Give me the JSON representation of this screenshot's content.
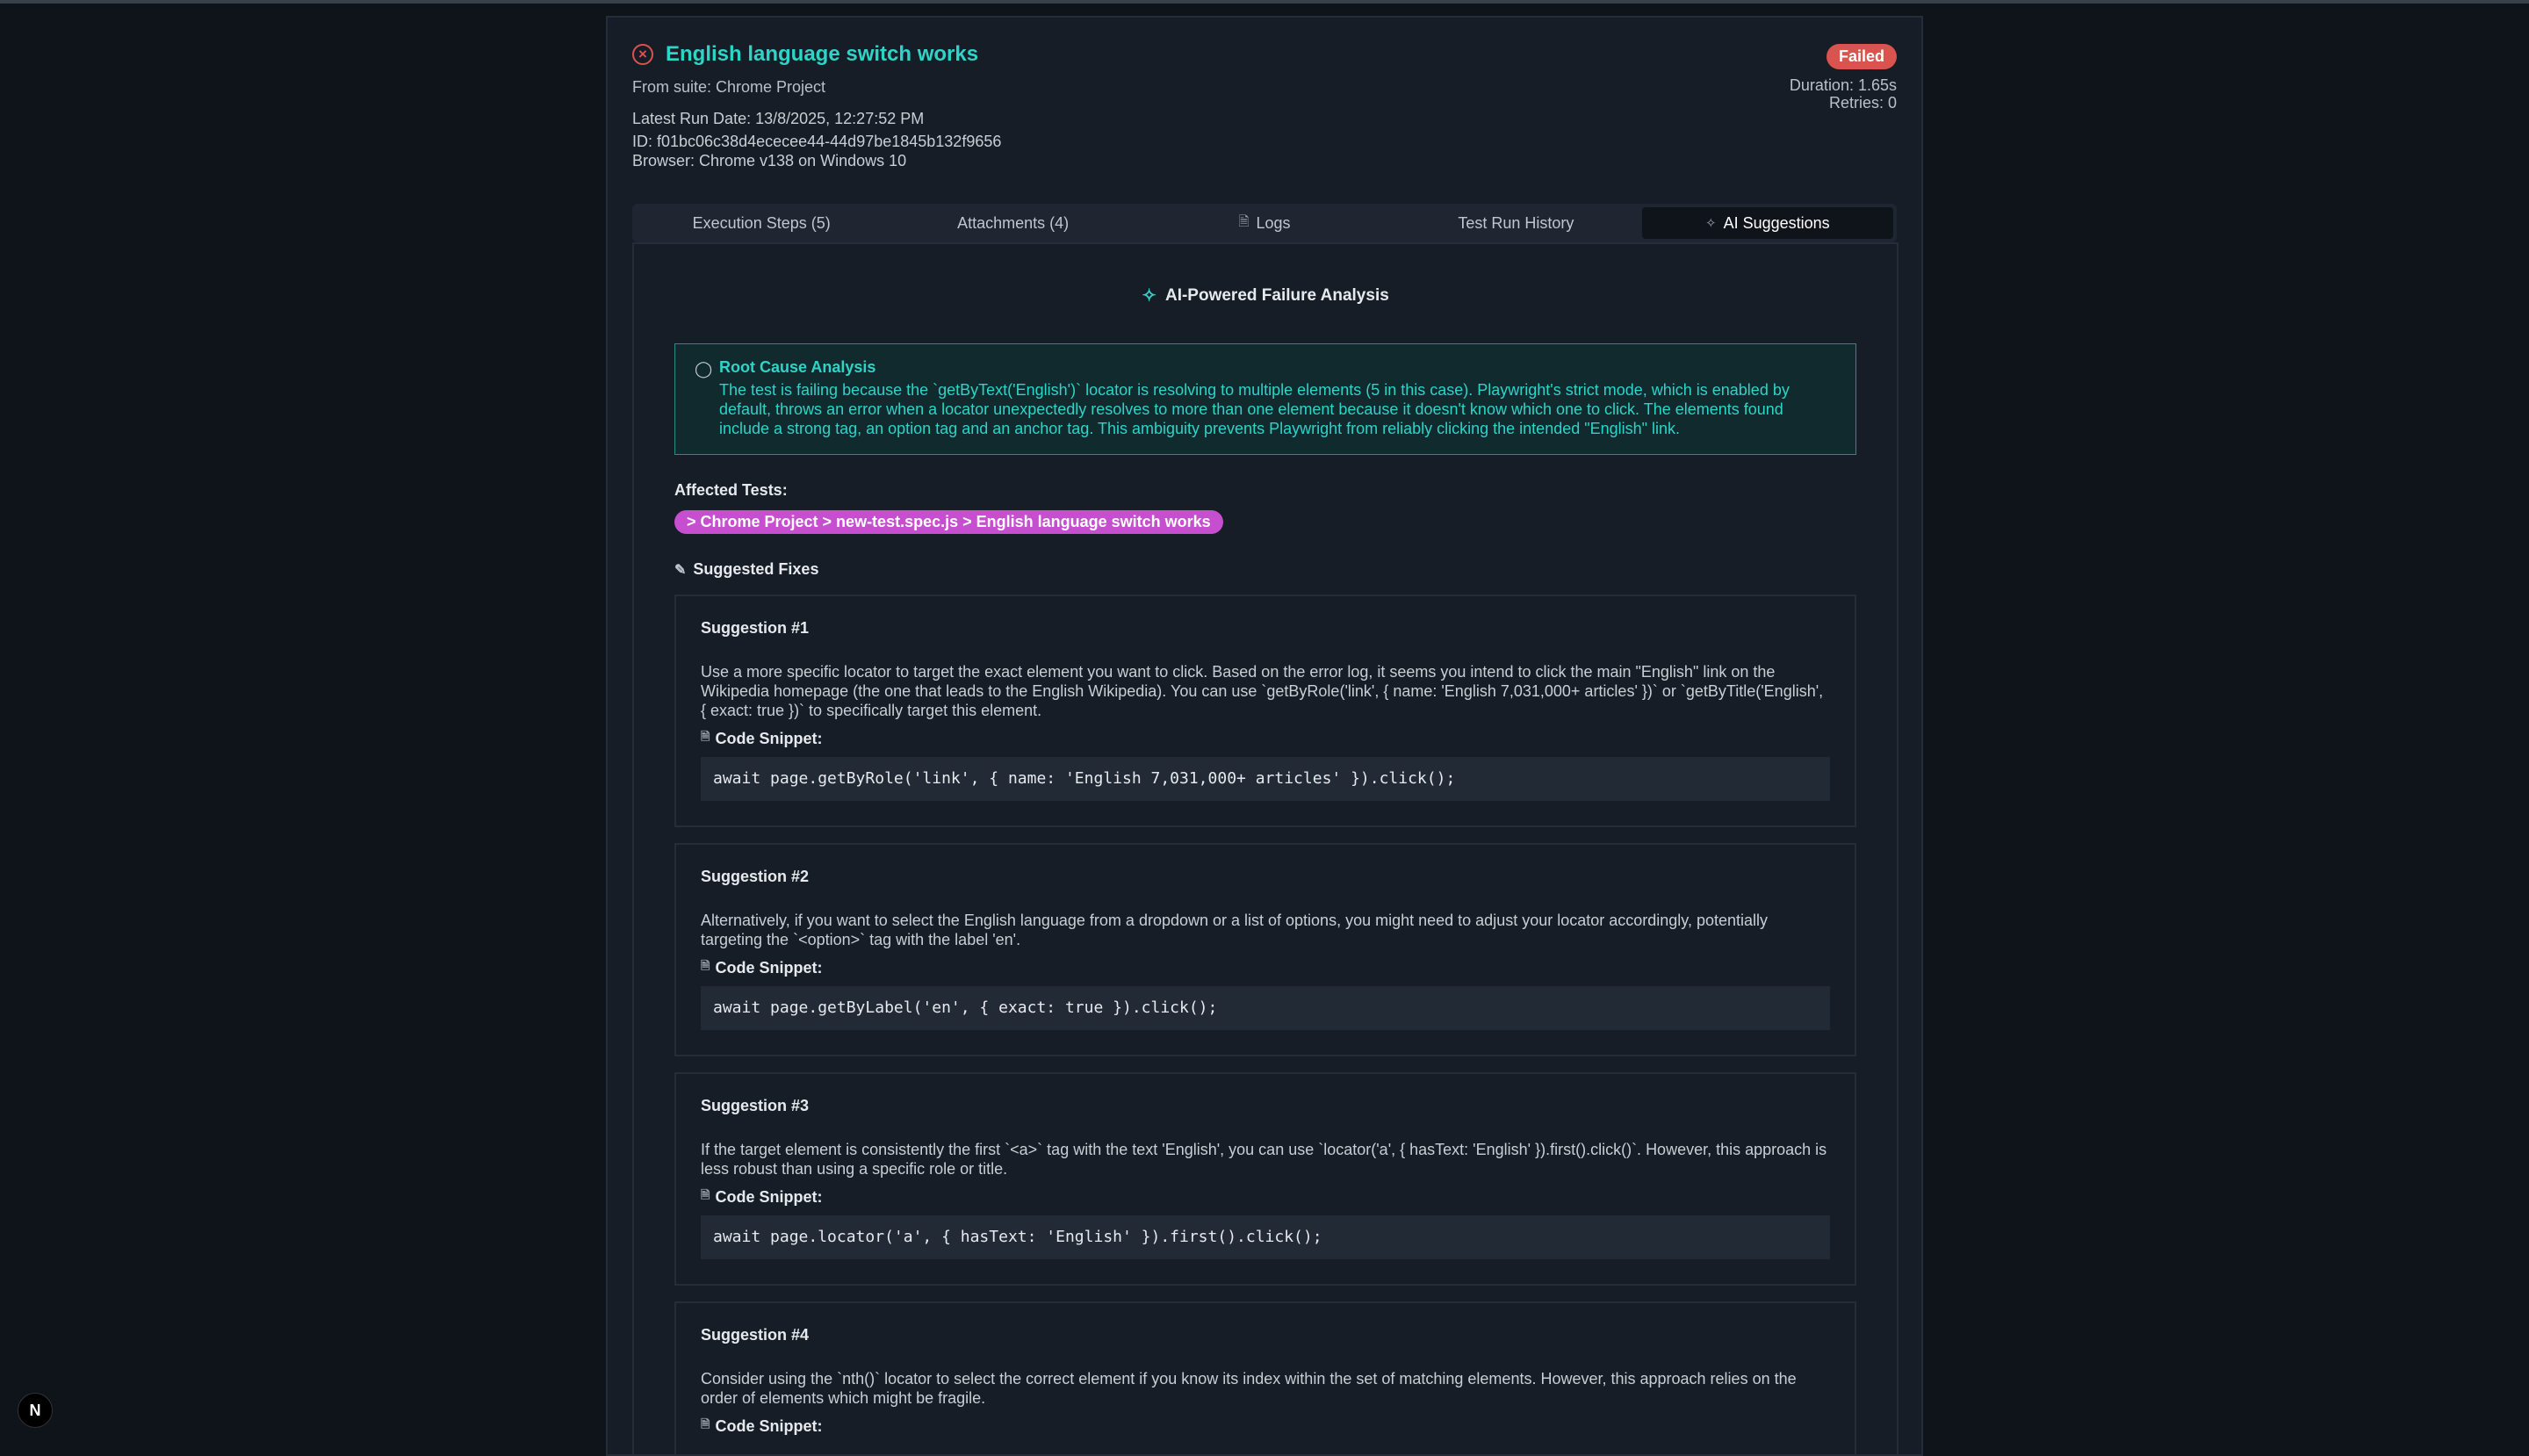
{
  "test": {
    "title": "English language switch works",
    "suite": "From suite: Chrome Project",
    "run_date": "Latest Run Date: 13/8/2025, 12:27:52 PM",
    "id": "ID: f01bc06c38d4ececee44-44d97be1845b132f9656",
    "browser": "Browser: Chrome v138 on Windows 10",
    "status": "Failed",
    "duration": "Duration: 1.65s",
    "retries": "Retries: 0"
  },
  "tabs": [
    {
      "label": "Execution Steps (5)"
    },
    {
      "label": "Attachments (4)"
    },
    {
      "label": "Logs"
    },
    {
      "label": "Test Run History"
    },
    {
      "label": "AI Suggestions"
    }
  ],
  "ai": {
    "heading": "AI-Powered Failure Analysis",
    "root_title": "Root Cause Analysis",
    "root_text": "The test is failing because the `getByText('English')` locator is resolving to multiple elements (5 in this case). Playwright's strict mode, which is enabled by default, throws an error when a locator unexpectedly resolves to more than one element because it doesn't know which one to click. The elements found include a strong tag, an option tag and an anchor tag. This ambiguity prevents Playwright from reliably clicking the intended \"English\" link.",
    "affected_label": "Affected Tests:",
    "affected_test": "> Chrome Project > new-test.spec.js > English language switch works",
    "fixes_label": "Suggested Fixes",
    "snippet_label": "Code Snippet:"
  },
  "suggestions": [
    {
      "title": "Suggestion #1",
      "text": "Use a more specific locator to target the exact element you want to click. Based on the error log, it seems you intend to click the main \"English\" link on the Wikipedia homepage (the one that leads to the English Wikipedia). You can use `getByRole('link', { name: 'English 7,031,000+ articles' })` or `getByTitle('English', { exact: true })` to specifically target this element.",
      "code": "await page.getByRole('link', { name: 'English 7,031,000+ articles' }).click();"
    },
    {
      "title": "Suggestion #2",
      "text": "Alternatively, if you want to select the English language from a dropdown or a list of options, you might need to adjust your locator accordingly, potentially targeting the `<option>` tag with the label 'en'.",
      "code": "await page.getByLabel('en', { exact: true }).click();"
    },
    {
      "title": "Suggestion #3",
      "text": "If the target element is consistently the first `<a>` tag with the text 'English', you can use `locator('a', { hasText: 'English' }).first().click()`. However, this approach is less robust than using a specific role or title.",
      "code": "await page.locator('a', { hasText: 'English' }).first().click();"
    },
    {
      "title": "Suggestion #4",
      "text": "Consider using the `nth()` locator to select the correct element if you know its index within the set of matching elements. However, this approach relies on the order of elements which might be fragile.",
      "code": ""
    }
  ],
  "colors": {
    "accent": "#2fd3c8",
    "failed": "#d9534f",
    "pill": "#c64fd0",
    "background": "#0f141b"
  },
  "icons": [
    "x-circle-icon",
    "file-icon",
    "sparkles-icon",
    "lightbulb-icon",
    "wrench-icon",
    "document-icon",
    "next-logo-icon"
  ]
}
